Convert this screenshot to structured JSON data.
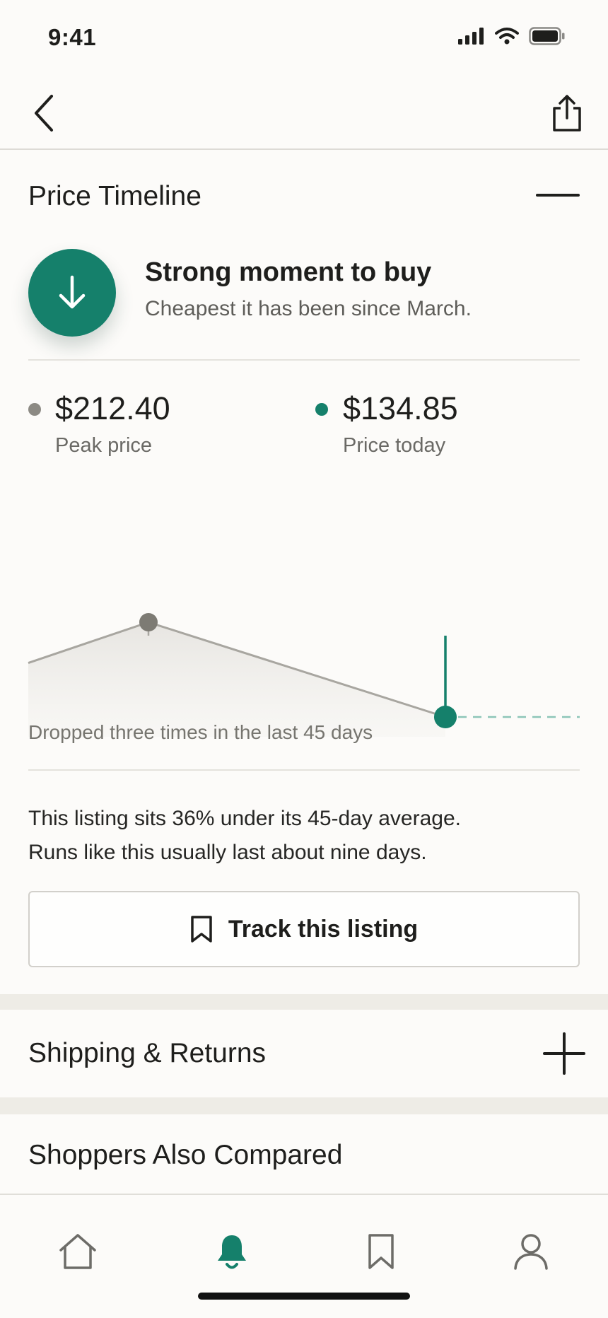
{
  "status": {
    "time": "9:41"
  },
  "price_timeline": {
    "title": "Price Timeline",
    "deal": {
      "title": "Strong moment to buy",
      "subtitle": "Cheapest it has been since March."
    },
    "peak": {
      "value": "$212.40",
      "label": "Peak price",
      "color": "#8c8a84"
    },
    "today": {
      "value": "$134.85",
      "label": "Price today",
      "color": "#15806b"
    },
    "caption": "Dropped three times in the last 45 days",
    "insight_line1": "This listing sits 36% under its 45-day average.",
    "insight_line2": "Runs like this usually last about nine days.",
    "track_label": "Track this listing"
  },
  "chart_data": {
    "type": "line",
    "series": [
      {
        "values": [
          179.1,
          212.4,
          134.85
        ]
      }
    ],
    "markers": [
      {
        "label": "Peak price",
        "value": 212.4
      },
      {
        "label": "Price today",
        "value": 134.85
      }
    ],
    "projection": {
      "style": "dashed",
      "value": 134.85
    },
    "grid": false,
    "colors": {
      "history": "#a8a6a0",
      "today": "#15806b",
      "peak_marker": "#7d7b74"
    }
  },
  "sections": {
    "shipping": {
      "title": "Shipping & Returns"
    },
    "compared": {
      "title": "Shoppers Also Compared"
    }
  },
  "tabs": [
    {
      "icon": "home-icon",
      "active": false
    },
    {
      "icon": "bell-icon",
      "active": true
    },
    {
      "icon": "bookmark-icon",
      "active": false
    },
    {
      "icon": "profile-icon",
      "active": false
    }
  ],
  "colors": {
    "accent": "#15806b",
    "background": "#fcfbf9",
    "band": "#eeece6"
  }
}
